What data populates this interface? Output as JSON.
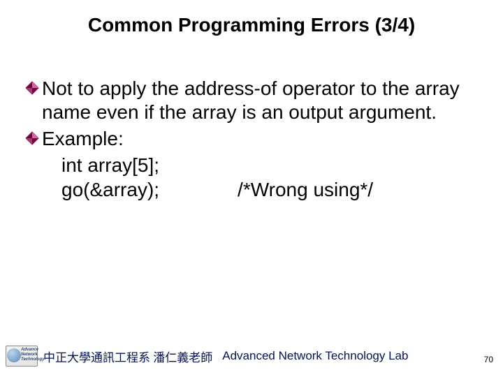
{
  "title": "Common Programming Errors (3/4)",
  "bullets": [
    {
      "text": "Not to apply the address-of operator to the array name even if the array is an output argument."
    },
    {
      "text": "Example:"
    }
  ],
  "code": {
    "line1": "int array[5];",
    "line2_left": "go(&array);",
    "line2_right": "/*Wrong using*/"
  },
  "footer": {
    "logo_lines": [
      "Advance",
      "Network",
      "Technology"
    ],
    "cn": "中正大學通訊工程系 潘仁義老師",
    "en": "Advanced Network Technology Lab"
  },
  "page_number": "70",
  "colors": {
    "bullet_outline": "#9a0f55",
    "bullet_fill_dark": "#6b0a3c",
    "bullet_fill_light": "#d766a6"
  }
}
